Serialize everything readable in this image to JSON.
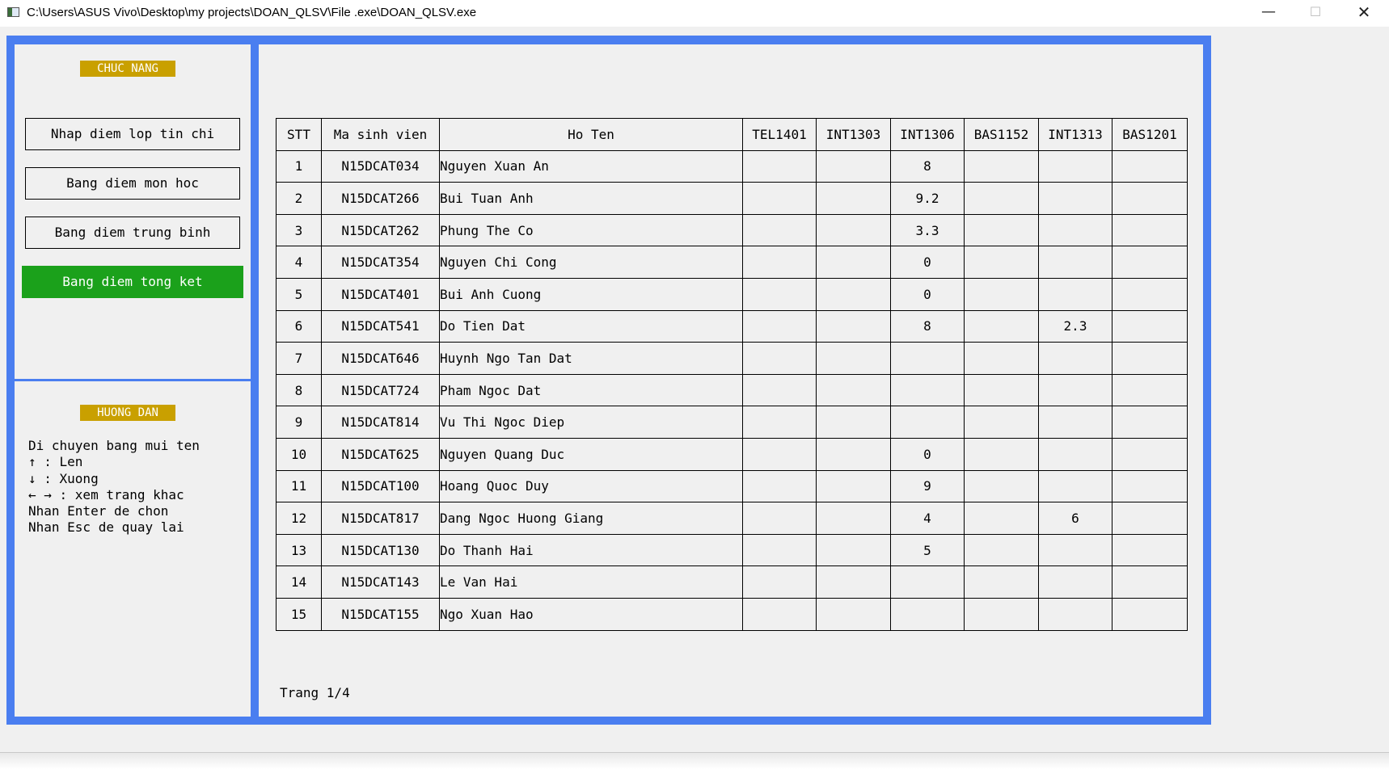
{
  "window": {
    "title": "C:\\Users\\ASUS Vivo\\Desktop\\my projects\\DOAN_QLSV\\File .exe\\DOAN_QLSV.exe",
    "minimize": "—",
    "maximize": "☐",
    "close": "✕"
  },
  "sidebar": {
    "functions_title": "CHUC NANG",
    "menu": [
      {
        "label": "Nhap diem lop tin chi"
      },
      {
        "label": "Bang diem mon hoc"
      },
      {
        "label": "Bang diem trung binh"
      },
      {
        "label": "Bang diem tong ket",
        "selected": true
      }
    ],
    "guide_title": "HUONG DAN",
    "guide_lines": [
      "Di chuyen bang mui ten",
      "↑ : Len",
      "↓ : Xuong",
      "← → : xem trang khac",
      "Nhan Enter de chon",
      "Nhan Esc de quay lai"
    ]
  },
  "table": {
    "headers": [
      "STT",
      "Ma sinh vien",
      "Ho Ten",
      "TEL1401",
      "INT1303",
      "INT1306",
      "BAS1152",
      "INT1313",
      "BAS1201"
    ],
    "rows": [
      [
        "1",
        "N15DCAT034",
        "Nguyen Xuan An",
        "",
        "",
        "8",
        "",
        "",
        ""
      ],
      [
        "2",
        "N15DCAT266",
        "Bui Tuan Anh",
        "",
        "",
        "9.2",
        "",
        "",
        ""
      ],
      [
        "3",
        "N15DCAT262",
        "Phung The Co",
        "",
        "",
        "3.3",
        "",
        "",
        ""
      ],
      [
        "4",
        "N15DCAT354",
        "Nguyen Chi Cong",
        "",
        "",
        "0",
        "",
        "",
        ""
      ],
      [
        "5",
        "N15DCAT401",
        "Bui Anh Cuong",
        "",
        "",
        "0",
        "",
        "",
        ""
      ],
      [
        "6",
        "N15DCAT541",
        "Do Tien Dat",
        "",
        "",
        "8",
        "",
        "2.3",
        ""
      ],
      [
        "7",
        "N15DCAT646",
        "Huynh Ngo Tan Dat",
        "",
        "",
        "",
        "",
        "",
        ""
      ],
      [
        "8",
        "N15DCAT724",
        "Pham Ngoc Dat",
        "",
        "",
        "",
        "",
        "",
        ""
      ],
      [
        "9",
        "N15DCAT814",
        "Vu Thi Ngoc Diep",
        "",
        "",
        "",
        "",
        "",
        ""
      ],
      [
        "10",
        "N15DCAT625",
        "Nguyen Quang Duc",
        "",
        "",
        "0",
        "",
        "",
        ""
      ],
      [
        "11",
        "N15DCAT100",
        "Hoang Quoc Duy",
        "",
        "",
        "9",
        "",
        "",
        ""
      ],
      [
        "12",
        "N15DCAT817",
        "Dang Ngoc Huong Giang",
        "",
        "",
        "4",
        "",
        "6",
        ""
      ],
      [
        "13",
        "N15DCAT130",
        "Do Thanh Hai",
        "",
        "",
        "5",
        "",
        "",
        ""
      ],
      [
        "14",
        "N15DCAT143",
        "Le Van Hai",
        "",
        "",
        "",
        "",
        "",
        ""
      ],
      [
        "15",
        "N15DCAT155",
        "Ngo Xuan Hao",
        "",
        "",
        "",
        "",
        "",
        ""
      ]
    ]
  },
  "pagination": {
    "label": "Trang 1/4"
  },
  "colors": {
    "frame_blue": "#4a7ef0",
    "title_tag_gold": "#c9a000",
    "active_green": "#1ba11b",
    "panel_bg": "#f0f0f0"
  }
}
